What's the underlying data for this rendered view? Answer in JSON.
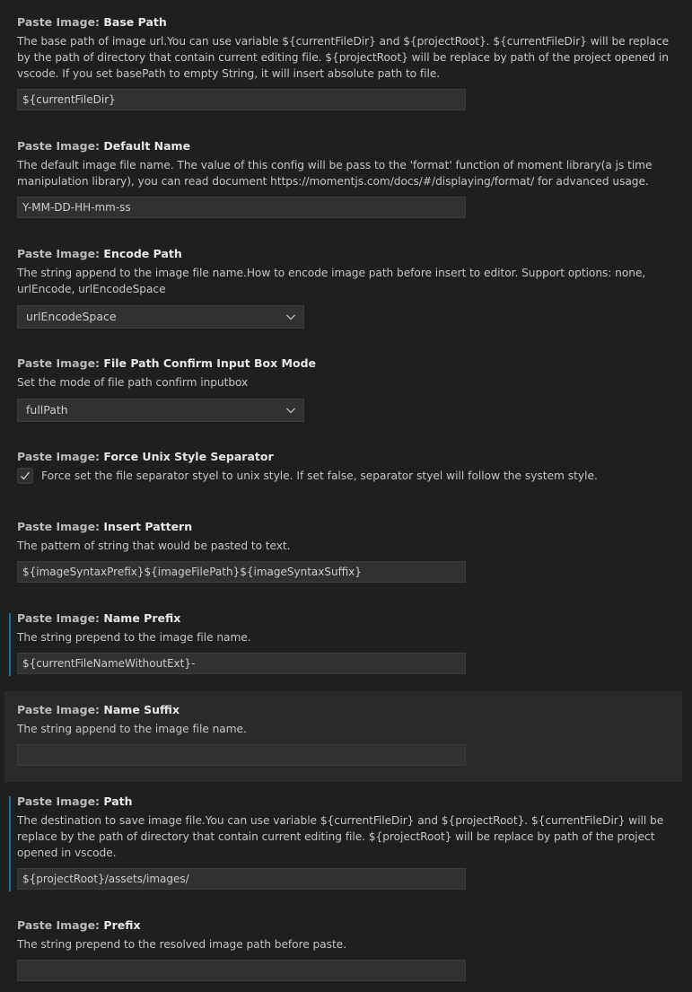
{
  "settings": [
    {
      "category": "Paste Image: ",
      "name": "Base Path",
      "description": "The base path of image url.You can use variable ${currentFileDir} and ${projectRoot}. ${currentFileDir} will be replace by the path of directory that contain current editing file. ${projectRoot} will be replace by path of the project opened in vscode. If you set basePath to empty String, it will insert absolute path to file.",
      "value": "${currentFileDir}"
    },
    {
      "category": "Paste Image: ",
      "name": "Default Name",
      "description": "The default image file name. The value of this config will be pass to the 'format' function of moment library(a js time manipulation library), you can read document https://momentjs.com/docs/#/displaying/format/ for advanced usage.",
      "value": "Y-MM-DD-HH-mm-ss"
    },
    {
      "category": "Paste Image: ",
      "name": "Encode Path",
      "description": "The string append to the image file name.How to encode image path before insert to editor. Support options: none, urlEncode, urlEncodeSpace",
      "value": "urlEncodeSpace"
    },
    {
      "category": "Paste Image: ",
      "name": "File Path Confirm Input Box Mode",
      "description": "Set the mode of file path confirm inputbox",
      "value": "fullPath"
    },
    {
      "category": "Paste Image: ",
      "name": "Force Unix Style Separator",
      "description": "Force set the file separator styel to unix style. If set false, separator styel will follow the system style.",
      "checked": true
    },
    {
      "category": "Paste Image: ",
      "name": "Insert Pattern",
      "description": "The pattern of string that would be pasted to text.",
      "value": "${imageSyntaxPrefix}${imageFilePath}${imageSyntaxSuffix}"
    },
    {
      "category": "Paste Image: ",
      "name": "Name Prefix",
      "description": "The string prepend to the image file name.",
      "value": "${currentFileNameWithoutExt}-"
    },
    {
      "category": "Paste Image: ",
      "name": "Name Suffix",
      "description": "The string append to the image file name.",
      "value": ""
    },
    {
      "category": "Paste Image: ",
      "name": "Path",
      "description": "The destination to save image file.You can use variable ${currentFileDir} and ${projectRoot}. ${currentFileDir} will be replace by the path of directory that contain current editing file. ${projectRoot} will be replace by path of the project opened in vscode.",
      "value": "${projectRoot}/assets/images/"
    },
    {
      "category": "Paste Image: ",
      "name": "Prefix",
      "description": "The string prepend to the resolved image path before paste.",
      "value": ""
    }
  ],
  "colors": {
    "background": "#1f1f1f",
    "input_background": "#313131",
    "modified_indicator": "#1b6fa3",
    "hover_background": "#2a2a2a"
  }
}
